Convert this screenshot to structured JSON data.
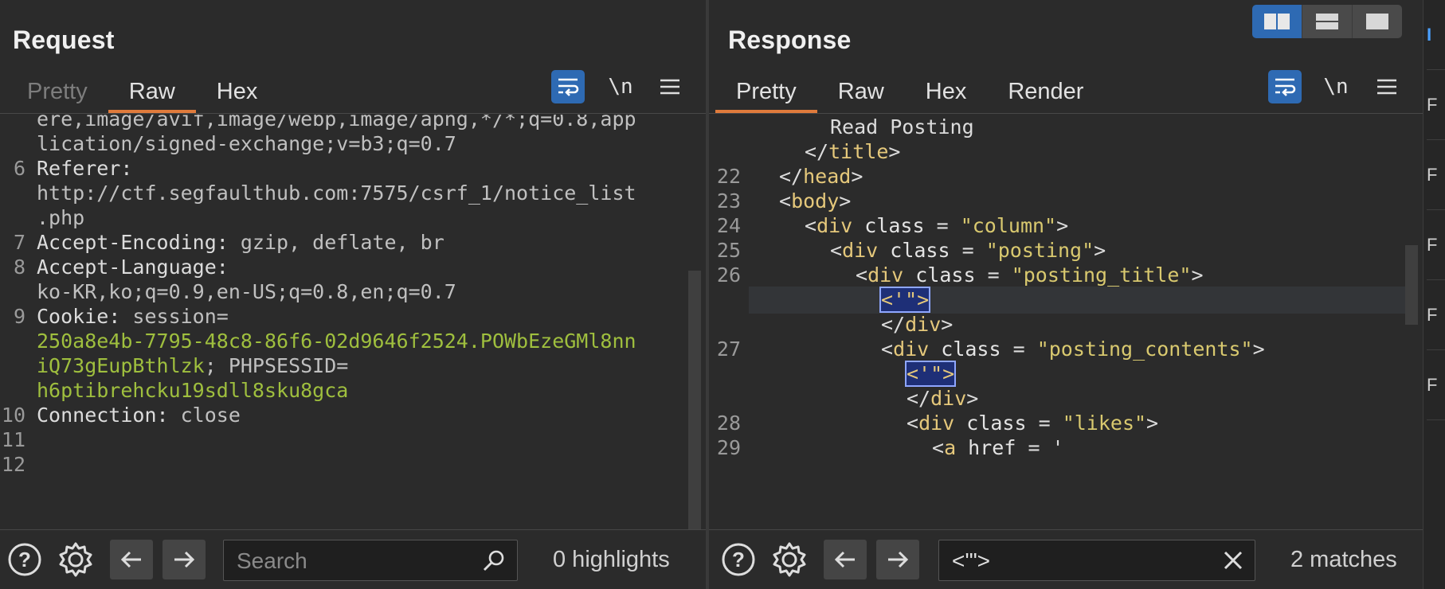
{
  "layout_toggle": {
    "icons": [
      "side-by-side-layout-icon",
      "stacked-layout-icon",
      "single-pane-layout-icon"
    ],
    "active": 0
  },
  "request": {
    "title": "Request",
    "tabs": [
      {
        "label": "Pretty",
        "active": false
      },
      {
        "label": "Raw",
        "active": true
      },
      {
        "label": "Hex",
        "active": false
      }
    ],
    "toolbar": {
      "newline_label": "\\n"
    },
    "lines": [
      {
        "n": "",
        "segments": [
          {
            "t": "ere,image/avif,image/webp,image/apng,*/*;q=0.8,app",
            "c": "val"
          }
        ]
      },
      {
        "n": "",
        "segments": [
          {
            "t": "lication/signed-exchange;v=b3;q=0.7",
            "c": "val"
          }
        ]
      },
      {
        "n": "6",
        "segments": [
          {
            "t": "Referer:",
            "c": "key"
          }
        ]
      },
      {
        "n": "",
        "segments": [
          {
            "t": "http://ctf.segfaulthub.com:7575/csrf_1/notice_list",
            "c": "val"
          }
        ]
      },
      {
        "n": "",
        "segments": [
          {
            "t": ".php",
            "c": "val"
          }
        ]
      },
      {
        "n": "7",
        "segments": [
          {
            "t": "Accept-Encoding:",
            "c": "key"
          },
          {
            "t": " gzip, deflate, br",
            "c": "val"
          }
        ]
      },
      {
        "n": "8",
        "segments": [
          {
            "t": "Accept-Language:",
            "c": "key"
          }
        ]
      },
      {
        "n": "",
        "segments": [
          {
            "t": "ko-KR,ko;q=0.9,en-US;q=0.8,en;q=0.7",
            "c": "val"
          }
        ]
      },
      {
        "n": "9",
        "segments": [
          {
            "t": "Cookie:",
            "c": "key"
          },
          {
            "t": " session=",
            "c": "val"
          }
        ]
      },
      {
        "n": "",
        "segments": [
          {
            "t": "250a8e4b-7795-48c8-86f6-02d9646f2524.POWbEzeGMl8nn",
            "c": "ck"
          }
        ]
      },
      {
        "n": "",
        "segments": [
          {
            "t": "iQ73gEupBthlzk",
            "c": "ck"
          },
          {
            "t": "; PHPSESSID=",
            "c": "val"
          }
        ]
      },
      {
        "n": "",
        "segments": [
          {
            "t": "h6ptibrehcku19sdll8sku8gca",
            "c": "ck"
          }
        ]
      },
      {
        "n": "10",
        "segments": [
          {
            "t": "Connection:",
            "c": "key"
          },
          {
            "t": " close",
            "c": "val"
          }
        ]
      },
      {
        "n": "11",
        "segments": []
      },
      {
        "n": "12",
        "segments": []
      }
    ],
    "search": {
      "placeholder": "Search",
      "value": ""
    },
    "status": "0 highlights"
  },
  "response": {
    "title": "Response",
    "tabs": [
      {
        "label": "Pretty",
        "active": true
      },
      {
        "label": "Raw",
        "active": false
      },
      {
        "label": "Hex",
        "active": false
      },
      {
        "label": "Render",
        "active": false
      }
    ],
    "toolbar": {
      "newline_label": "\\n"
    },
    "lines": [
      {
        "n": "",
        "indent": 3,
        "segments": [
          {
            "t": "Read Posting",
            "c": "txt"
          }
        ]
      },
      {
        "n": "",
        "indent": 2,
        "segments": [
          {
            "t": "</",
            "c": "txt"
          },
          {
            "t": "title",
            "c": "tag"
          },
          {
            "t": ">",
            "c": "txt"
          }
        ]
      },
      {
        "n": "22",
        "indent": 1,
        "segments": [
          {
            "t": "</",
            "c": "txt"
          },
          {
            "t": "head",
            "c": "tag"
          },
          {
            "t": ">",
            "c": "txt"
          }
        ]
      },
      {
        "n": "23",
        "indent": 1,
        "segments": [
          {
            "t": "<",
            "c": "txt"
          },
          {
            "t": "body",
            "c": "tag"
          },
          {
            "t": ">",
            "c": "txt"
          }
        ]
      },
      {
        "n": "24",
        "indent": 2,
        "segments": [
          {
            "t": "<",
            "c": "txt"
          },
          {
            "t": "div",
            "c": "tag"
          },
          {
            "t": " class",
            "c": "attr"
          },
          {
            "t": " = ",
            "c": "txt"
          },
          {
            "t": "\"column\"",
            "c": "str"
          },
          {
            "t": ">",
            "c": "txt"
          }
        ]
      },
      {
        "n": "25",
        "indent": 3,
        "segments": [
          {
            "t": "<",
            "c": "txt"
          },
          {
            "t": "div",
            "c": "tag"
          },
          {
            "t": " class",
            "c": "attr"
          },
          {
            "t": " = ",
            "c": "txt"
          },
          {
            "t": "\"posting\"",
            "c": "str"
          },
          {
            "t": ">",
            "c": "txt"
          }
        ]
      },
      {
        "n": "26",
        "indent": 4,
        "segments": [
          {
            "t": "<",
            "c": "txt"
          },
          {
            "t": "div",
            "c": "tag"
          },
          {
            "t": " class",
            "c": "attr"
          },
          {
            "t": " = ",
            "c": "txt"
          },
          {
            "t": "\"posting_title\"",
            "c": "str"
          },
          {
            "t": ">",
            "c": "txt"
          }
        ]
      },
      {
        "n": "",
        "indent": 5,
        "current": true,
        "segments": [
          {
            "t": "<'\">",
            "c": "mark"
          }
        ]
      },
      {
        "n": "",
        "indent": 5,
        "segments": [
          {
            "t": "</",
            "c": "txt"
          },
          {
            "t": "div",
            "c": "tag"
          },
          {
            "t": ">",
            "c": "txt"
          }
        ]
      },
      {
        "n": "27",
        "indent": 5,
        "segments": [
          {
            "t": "<",
            "c": "txt"
          },
          {
            "t": "div",
            "c": "tag"
          },
          {
            "t": " class",
            "c": "attr"
          },
          {
            "t": " = ",
            "c": "txt"
          },
          {
            "t": "\"posting_contents\"",
            "c": "str"
          },
          {
            "t": ">",
            "c": "txt"
          }
        ]
      },
      {
        "n": "",
        "indent": 6,
        "segments": [
          {
            "t": "<'\">",
            "c": "mark"
          }
        ]
      },
      {
        "n": "",
        "indent": 6,
        "segments": [
          {
            "t": "</",
            "c": "txt"
          },
          {
            "t": "div",
            "c": "tag"
          },
          {
            "t": ">",
            "c": "txt"
          }
        ]
      },
      {
        "n": "28",
        "indent": 6,
        "segments": [
          {
            "t": "<",
            "c": "txt"
          },
          {
            "t": "div",
            "c": "tag"
          },
          {
            "t": " class",
            "c": "attr"
          },
          {
            "t": " = ",
            "c": "txt"
          },
          {
            "t": "\"likes\"",
            "c": "str"
          },
          {
            "t": ">",
            "c": "txt"
          }
        ]
      },
      {
        "n": "29",
        "indent": 7,
        "segments": [
          {
            "t": "<",
            "c": "txt"
          },
          {
            "t": "a",
            "c": "tag"
          },
          {
            "t": " href",
            "c": "attr"
          },
          {
            "t": " = '",
            "c": "txt"
          }
        ]
      }
    ],
    "search": {
      "placeholder": "Search",
      "value": "<'\">"
    },
    "status": "2 matches"
  },
  "right_strip": {
    "items": [
      "I",
      "F",
      "F",
      "F",
      "F",
      "F"
    ]
  }
}
